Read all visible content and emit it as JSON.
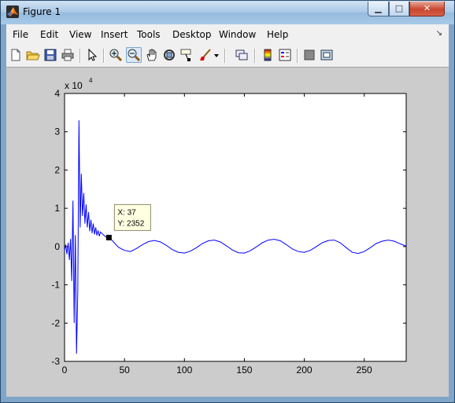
{
  "window": {
    "title": "Figure 1"
  },
  "menu": [
    "File",
    "Edit",
    "View",
    "Insert",
    "Tools",
    "Desktop",
    "Window",
    "Help"
  ],
  "toolbar_icons": [
    "new-figure-icon",
    "open-file-icon",
    "save-icon",
    "print-icon",
    "edit-plot-icon",
    "zoom-in-icon",
    "zoom-out-icon",
    "pan-icon",
    "rotate-3d-icon",
    "data-cursor-icon",
    "brush-icon",
    "brush-dropdown-icon",
    "link-plot-icon",
    "colorbar-icon",
    "legend-icon",
    "hide-plot-tools-icon",
    "show-plot-tools-icon"
  ],
  "datatip": {
    "x_text": "X: 37",
    "y_text": "Y: 2352",
    "x": 37,
    "y": 2352
  },
  "chart_data": {
    "type": "line",
    "title": "",
    "xlabel": "",
    "ylabel": "",
    "y_exponent_label": "x 10",
    "y_exponent_power": "4",
    "xlim": [
      0,
      285
    ],
    "ylim": [
      -30000,
      40000
    ],
    "x_ticks": [
      "0",
      "50",
      "100",
      "150",
      "200",
      "250"
    ],
    "x_tick_values": [
      0,
      50,
      100,
      150,
      200,
      250
    ],
    "y_ticks": [
      "4",
      "3",
      "2",
      "1",
      "0",
      "-1",
      "-2",
      "-3"
    ],
    "y_tick_values": [
      40000,
      30000,
      20000,
      10000,
      0,
      -10000,
      -20000,
      -30000
    ],
    "series": [
      {
        "color": "#0000ff",
        "x": [
          0,
          1,
          2,
          3,
          4,
          5,
          6,
          7,
          8,
          9,
          10,
          11,
          12,
          13,
          14,
          15,
          16,
          17,
          18,
          19,
          20,
          21,
          22,
          23,
          24,
          25,
          26,
          27,
          28,
          29,
          30,
          32,
          34,
          36,
          37,
          40,
          45,
          50,
          55,
          60,
          65,
          70,
          75,
          80,
          85,
          90,
          95,
          100,
          105,
          110,
          115,
          120,
          125,
          130,
          135,
          140,
          145,
          150,
          155,
          160,
          165,
          170,
          175,
          180,
          185,
          190,
          195,
          200,
          205,
          210,
          215,
          220,
          225,
          230,
          235,
          240,
          245,
          250,
          255,
          260,
          265,
          270,
          275,
          280,
          285
        ],
        "y": [
          -1000,
          500,
          -2000,
          1000,
          -3500,
          2000,
          -9000,
          12000,
          -20000,
          3000,
          -28000,
          -12000,
          33000,
          5000,
          19000,
          8000,
          14000,
          6000,
          11000,
          5000,
          9000,
          4000,
          7000,
          3500,
          6000,
          3200,
          5000,
          2900,
          4200,
          2700,
          3800,
          3200,
          2600,
          2400,
          2352,
          1500,
          -200,
          -1000,
          -1300,
          -500,
          500,
          1300,
          1600,
          1200,
          300,
          -800,
          -1500,
          -1700,
          -1200,
          -300,
          800,
          1500,
          1700,
          1200,
          200,
          -900,
          -1600,
          -1700,
          -1100,
          -100,
          1000,
          1700,
          1900,
          1500,
          500,
          -600,
          -1300,
          -1500,
          -1000,
          0,
          1000,
          1600,
          1700,
          1000,
          -300,
          -1500,
          -1800,
          -1300,
          -300,
          800,
          1400,
          1700,
          1400,
          700,
          100
        ]
      }
    ]
  }
}
